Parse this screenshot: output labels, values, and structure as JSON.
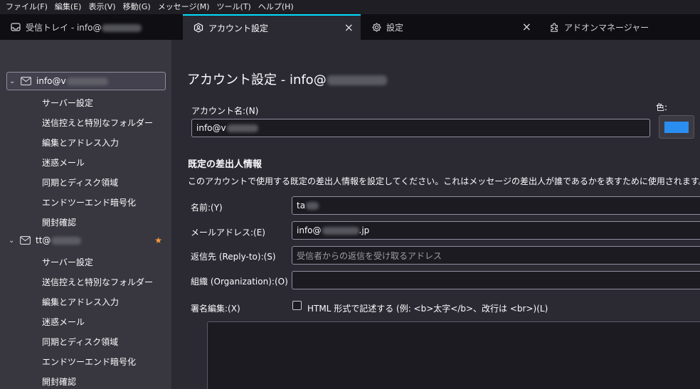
{
  "menu": [
    "ファイル(F)",
    "編集(E)",
    "表示(V)",
    "移動(G)",
    "メッセージ(M)",
    "ツール(T)",
    "ヘルプ(H)"
  ],
  "tabs": [
    {
      "label": "受信トレイ - info@",
      "icon": "inbox-icon"
    },
    {
      "label": "アカウント設定",
      "icon": "account-settings-icon",
      "active": true
    },
    {
      "label": "設定",
      "icon": "gear-icon"
    },
    {
      "label": "アドオンマネージャー",
      "icon": "puzzle-icon"
    }
  ],
  "sidebar": {
    "accounts": [
      {
        "name": "info@v",
        "selected": true,
        "items": [
          "サーバー設定",
          "送信控えと特別なフォルダー",
          "編集とアドレス入力",
          "迷惑メール",
          "同期とディスク領域",
          "エンドツーエンド暗号化",
          "開封確認"
        ]
      },
      {
        "name": "tt@",
        "default": true,
        "items": [
          "サーバー設定",
          "送信控えと特別なフォルダー",
          "編集とアドレス入力",
          "迷惑メール",
          "同期とディスク領域",
          "エンドツーエンド暗号化",
          "開封確認"
        ]
      }
    ]
  },
  "main": {
    "title": "アカウント設定 - info@",
    "account_name_label": "アカウント名:(N)",
    "account_name_value": "info@v",
    "color_label": "色:",
    "color_value": "#2a8ef0",
    "section_title": "既定の差出人情報",
    "section_desc": "このアカウントで使用する既定の差出人情報を設定してください。これはメッセージの差出人が誰であるかを表すために使用されます。",
    "fields": {
      "name": {
        "label": "名前:(Y)",
        "value": "ta"
      },
      "email": {
        "label": "メールアドレス:(E)",
        "value": "info@",
        "value_tail": ".jp"
      },
      "reply_to": {
        "label": "返信先 (Reply-to):(S)",
        "placeholder": "受信者からの返信を受け取るアドレス"
      },
      "org": {
        "label": "組織 (Organization):(O)",
        "value": ""
      }
    },
    "signature_label": "署名編集:(X)",
    "html_checkbox_label": "HTML 形式で記述する (例: <b>太字</b>、改行は <br>)(L)",
    "html_checkbox_checked": false
  },
  "colors": {
    "accent": "#00ddff",
    "star": "#ff9b3d",
    "swatch": "#2a8ef0"
  }
}
